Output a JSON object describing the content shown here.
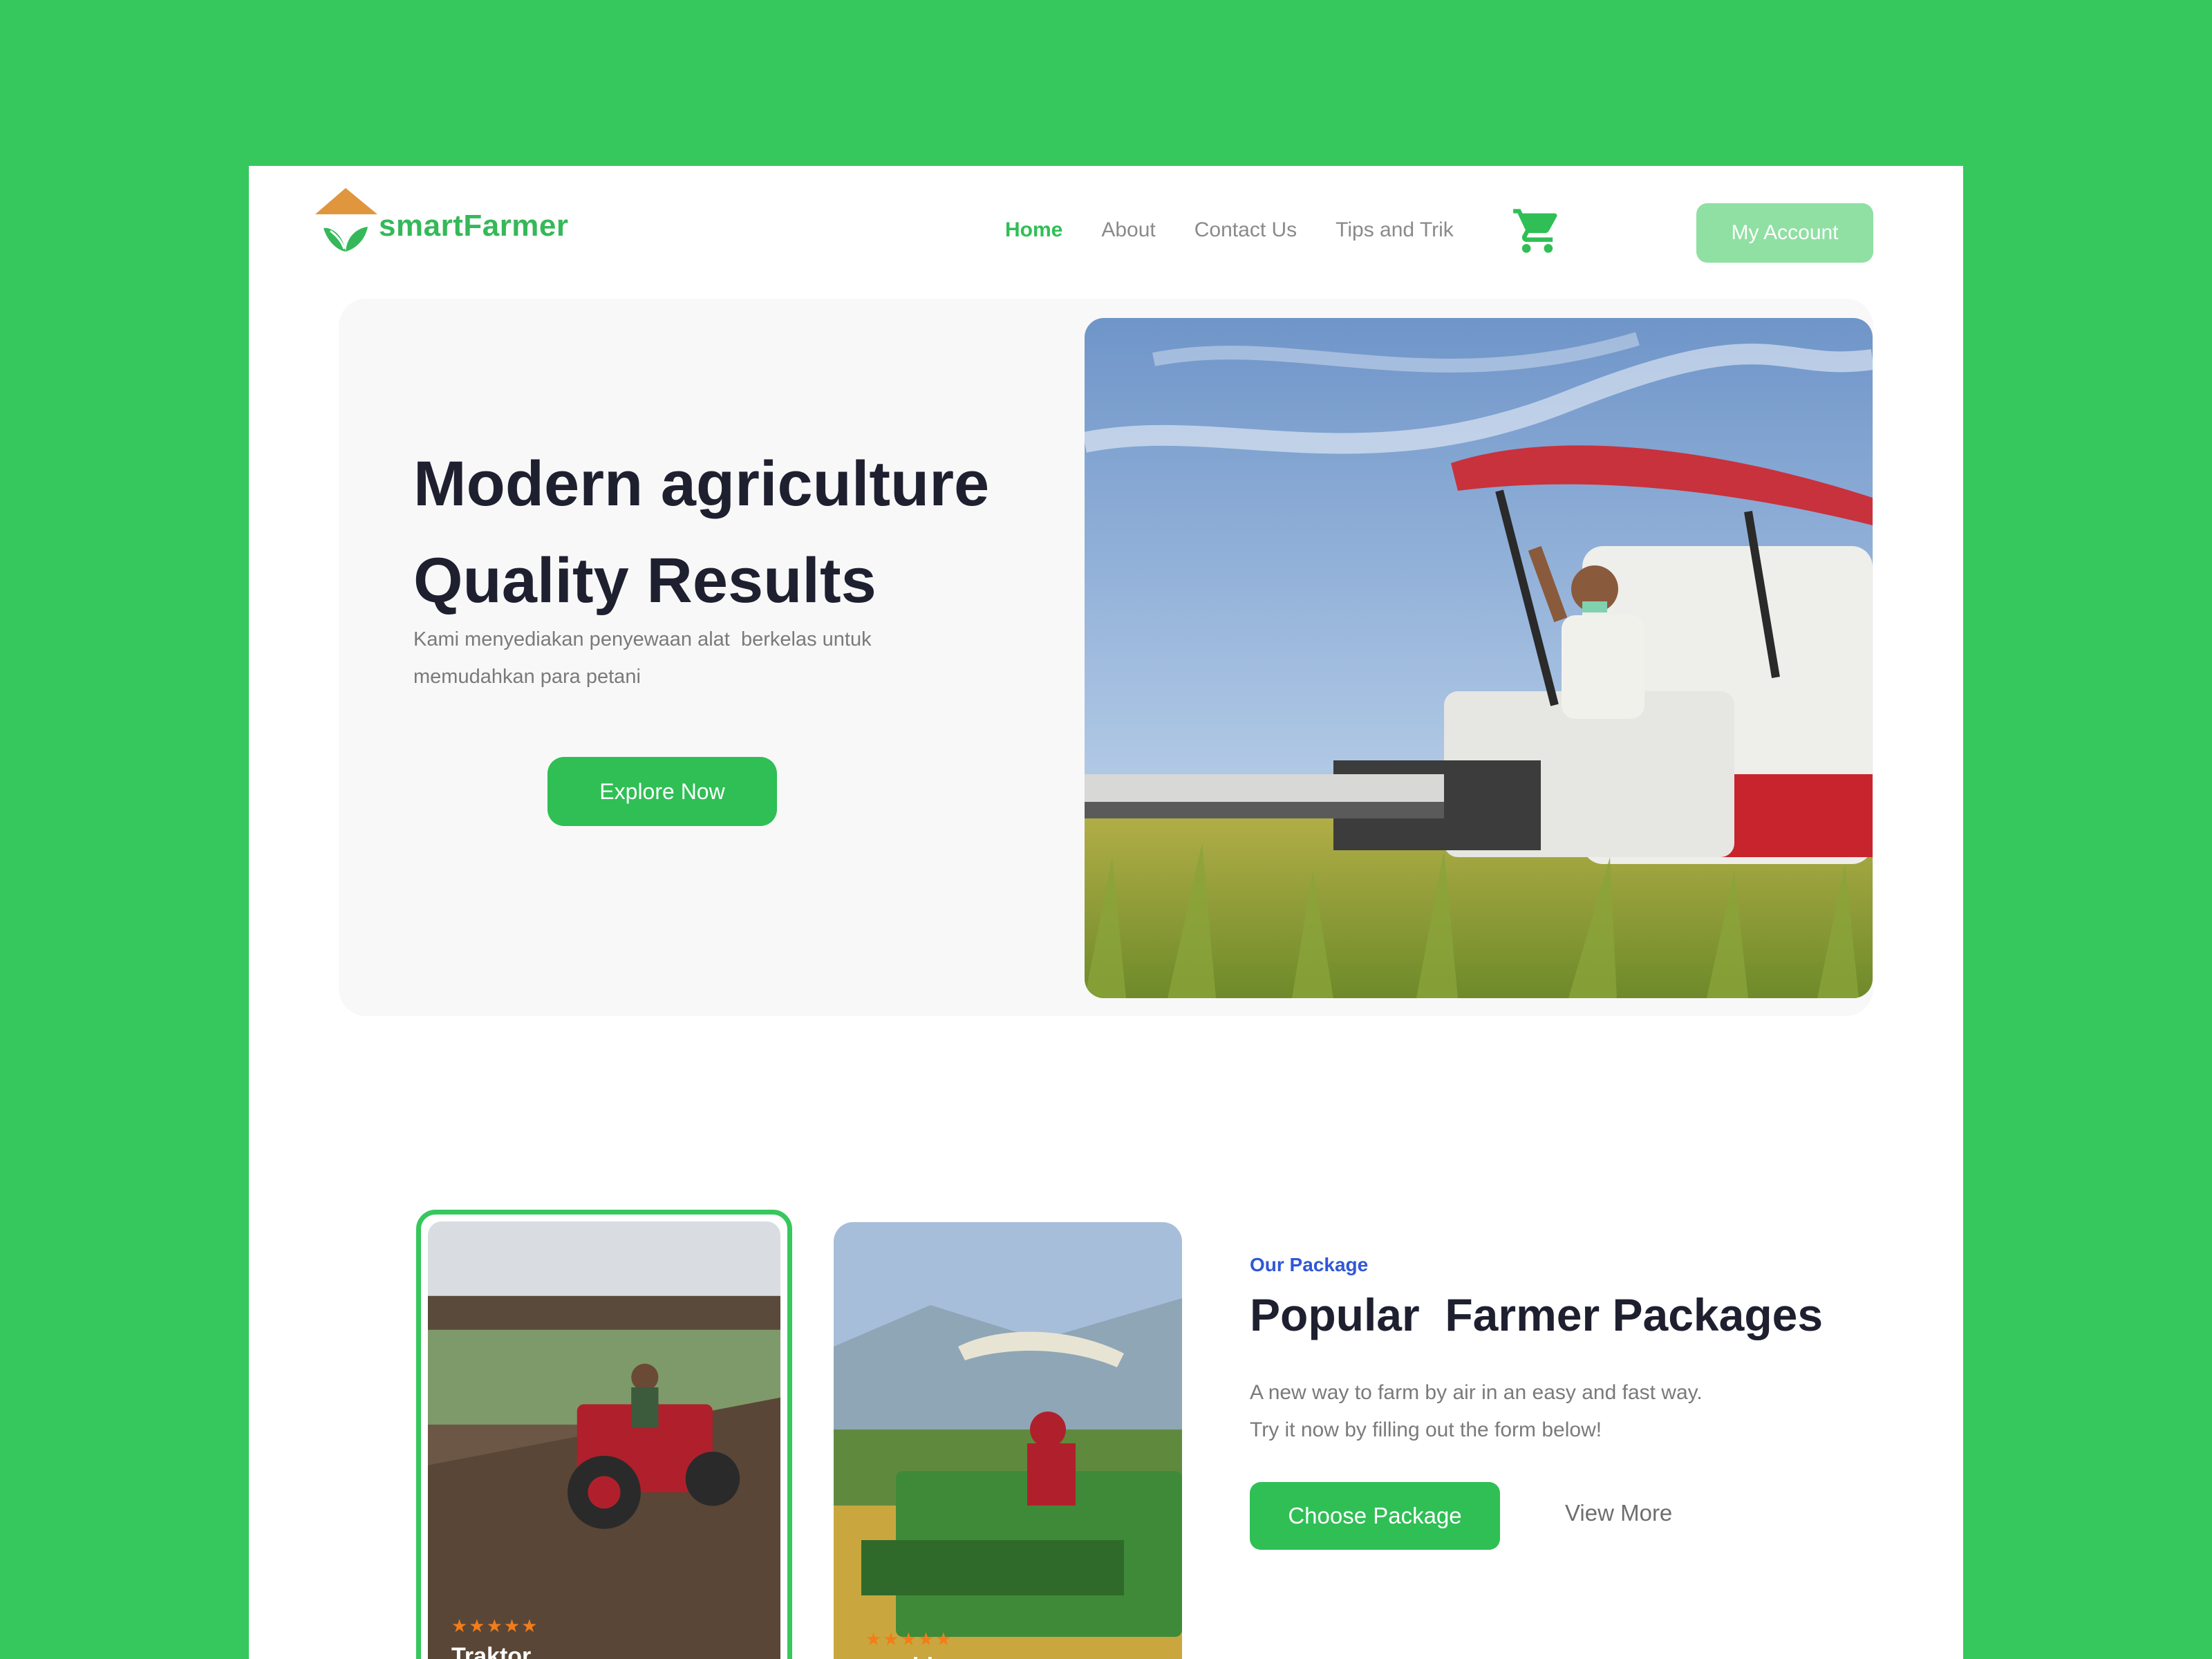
{
  "brand": {
    "name": "smartFarmer",
    "accent": "#2fbf55",
    "roof_color": "#e0963d"
  },
  "nav": {
    "items": [
      {
        "label": "Home",
        "active": true
      },
      {
        "label": "About",
        "active": false
      },
      {
        "label": "Contact Us",
        "active": false
      },
      {
        "label": "Tips and Trik",
        "active": false
      }
    ],
    "cart_icon": "cart-icon",
    "account_label": "My Account"
  },
  "hero": {
    "title_line1": "Modern agriculture",
    "title_line2": "Quality Results",
    "subtitle_line1": "Kami menyediakan penyewaan alat  berkelas untuk",
    "subtitle_line2": "memudahkan para petani",
    "cta_label": "Explore Now"
  },
  "packages": {
    "eyebrow": "Our Package",
    "title": "Popular  Farmer Packages",
    "desc_line1": "A new way to farm by air in an easy and fast way.",
    "desc_line2": "Try it now by filling out the form below!",
    "choose_label": "Choose Package",
    "view_more_label": "View More",
    "cards": [
      {
        "label": "Traktor",
        "rating": 5,
        "stars": "★★★★★"
      },
      {
        "label": "combi",
        "prefix": "na",
        "rating": 5,
        "stars": "★★★★★"
      }
    ]
  }
}
